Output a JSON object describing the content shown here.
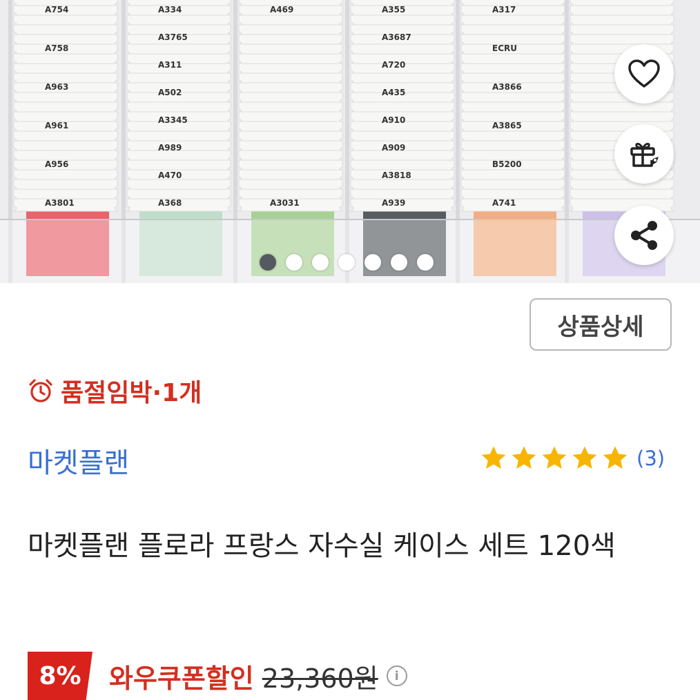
{
  "product_image": {
    "columns": [
      {
        "thread_color": "#e84b52",
        "labels": [
          "A754",
          "A758",
          "A963",
          "A961",
          "A956",
          "A3801"
        ]
      },
      {
        "thread_color": "#b9dbc2",
        "labels": [
          "A334",
          "A3765",
          "A311",
          "A502",
          "A3345",
          "A989",
          "A470",
          "A368"
        ]
      },
      {
        "thread_color": "#9ccc84",
        "labels": [
          "A469",
          "A3031"
        ]
      },
      {
        "thread_color": "#3d4348",
        "labels": [
          "A355",
          "A3687",
          "A720",
          "A435",
          "A910",
          "A909",
          "A3818",
          "A939"
        ]
      },
      {
        "thread_color": "#f3a36e",
        "labels": [
          "A317",
          "ECRU",
          "A3866",
          "A3865",
          "B5200",
          "A741"
        ]
      },
      {
        "thread_color": "#c7b9e6",
        "labels": []
      }
    ],
    "carousel": {
      "total": 7,
      "active": 0
    }
  },
  "actions": {
    "like_icon": "heart-icon",
    "gift_icon": "gift-icon",
    "share_icon": "share-icon"
  },
  "detail_button_label": "상품상세",
  "stock": {
    "icon": "alarm-clock-icon",
    "text": "품절임박·1개",
    "color": "#d32f20"
  },
  "seller": {
    "name": "마켓플랜",
    "color": "#3a6fd2"
  },
  "rating": {
    "stars": 5,
    "count_text": "(3)",
    "star_color": "#f7b500"
  },
  "product_title": "마켓플랜 플로라 프랑스 자수실 케이스 세트 120색",
  "price": {
    "discount_badge": "8%",
    "coupon_label": "와우쿠폰할인",
    "original_price": "23,360원",
    "info_icon": "info-icon",
    "badge_color": "#d8221b"
  }
}
